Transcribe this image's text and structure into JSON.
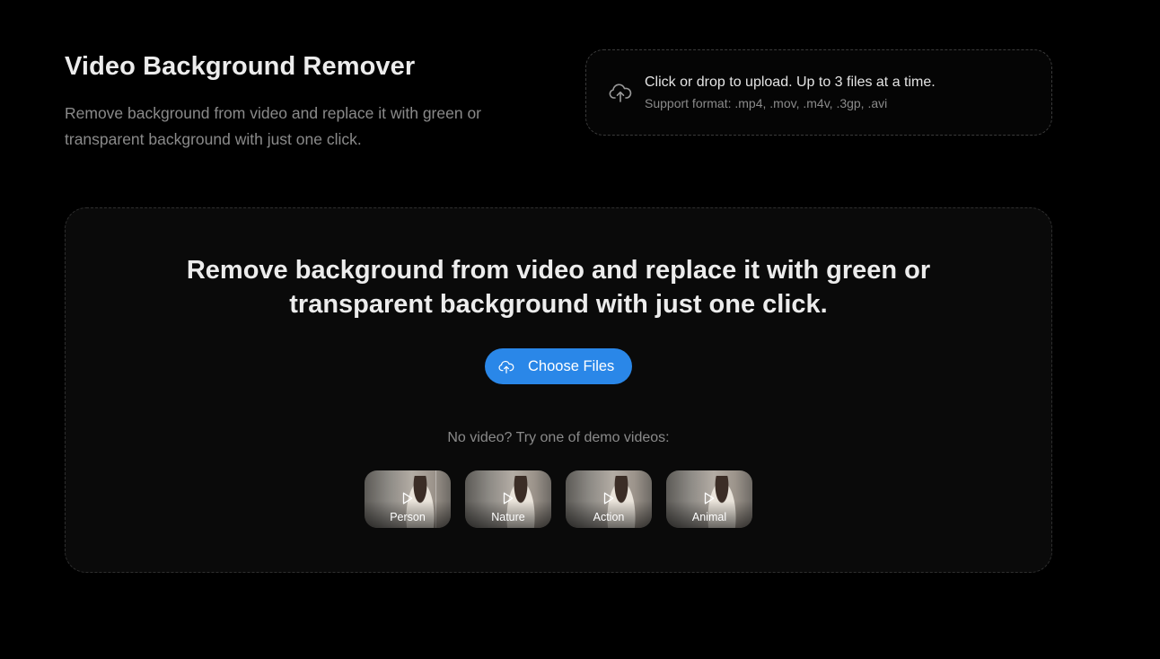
{
  "header": {
    "title": "Video Background Remover",
    "subtitle": "Remove background from video and replace it with green or transparent background with just one click."
  },
  "upload": {
    "main_text": "Click or drop to upload. Up to 3 files at a time.",
    "support_text": "Support format: .mp4, .mov, .m4v, .3gp, .avi",
    "icon": "cloud-upload-icon"
  },
  "main": {
    "heading": "Remove background from video and replace it with green or transparent background with just one click.",
    "choose_label": "Choose Files",
    "demo_label": "No video? Try one of demo videos:",
    "demos": [
      {
        "label": "Person"
      },
      {
        "label": "Nature"
      },
      {
        "label": "Action"
      },
      {
        "label": "Animal"
      }
    ]
  },
  "colors": {
    "background": "#000000",
    "card": "#0a0a0a",
    "accent": "#2a87e8",
    "muted_text": "#8a8a8a"
  }
}
